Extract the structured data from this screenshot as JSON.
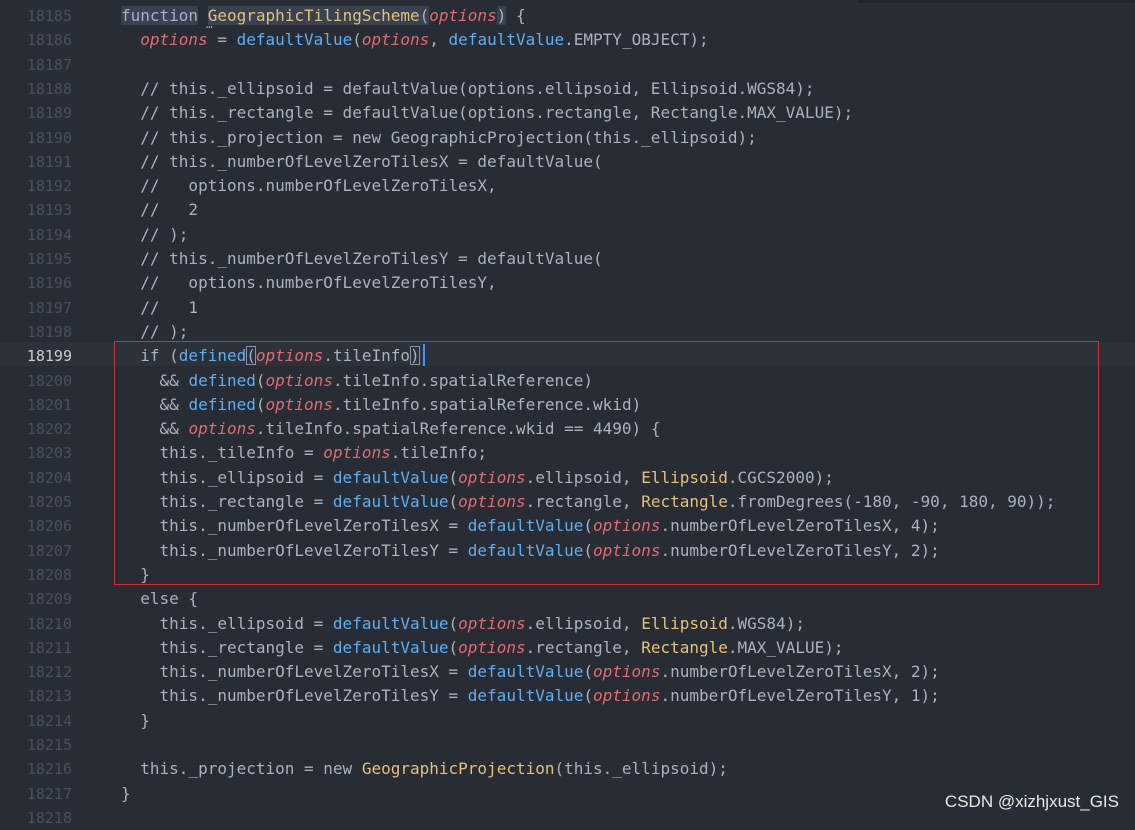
{
  "editor": {
    "current_line": "18199",
    "lines": [
      {
        "num": "18185",
        "tokens": [
          [
            "function",
            "kwsel"
          ],
          [
            " ",
            "plain"
          ],
          [
            "GeographicTilingScheme",
            "hlfn"
          ],
          [
            "(",
            "kwsel"
          ],
          [
            "options",
            "param"
          ],
          [
            ")",
            "kwsel"
          ],
          [
            " {",
            "plain"
          ]
        ]
      },
      {
        "num": "18186",
        "tokens": [
          [
            "  ",
            "plain"
          ],
          [
            "options",
            "param"
          ],
          [
            " = ",
            "plain"
          ],
          [
            "defaultValue",
            "fn"
          ],
          [
            "(",
            "plain"
          ],
          [
            "options",
            "param"
          ],
          [
            ", ",
            "plain"
          ],
          [
            "defaultValue",
            "fn"
          ],
          [
            ".EMPTY_OBJECT);",
            "plain"
          ]
        ]
      },
      {
        "num": "18187",
        "tokens": []
      },
      {
        "num": "18188",
        "tokens": [
          [
            "  // this._ellipsoid = defaultValue(options.ellipsoid, Ellipsoid.WGS84);",
            "comment"
          ]
        ]
      },
      {
        "num": "18189",
        "tokens": [
          [
            "  // this._rectangle = defaultValue(options.rectangle, Rectangle.MAX_VALUE);",
            "comment"
          ]
        ]
      },
      {
        "num": "18190",
        "tokens": [
          [
            "  // this._projection = new GeographicProjection(this._ellipsoid);",
            "comment"
          ]
        ]
      },
      {
        "num": "18191",
        "tokens": [
          [
            "  // this._numberOfLevelZeroTilesX = defaultValue(",
            "comment"
          ]
        ]
      },
      {
        "num": "18192",
        "tokens": [
          [
            "  //   options.numberOfLevelZeroTilesX,",
            "comment"
          ]
        ]
      },
      {
        "num": "18193",
        "tokens": [
          [
            "  //   2",
            "comment"
          ]
        ]
      },
      {
        "num": "18194",
        "tokens": [
          [
            "  // );",
            "comment"
          ]
        ]
      },
      {
        "num": "18195",
        "tokens": [
          [
            "  // this._numberOfLevelZeroTilesY = defaultValue(",
            "comment"
          ]
        ]
      },
      {
        "num": "18196",
        "tokens": [
          [
            "  //   options.numberOfLevelZeroTilesY,",
            "comment"
          ]
        ]
      },
      {
        "num": "18197",
        "tokens": [
          [
            "  //   1",
            "comment"
          ]
        ]
      },
      {
        "num": "18198",
        "tokens": [
          [
            "  // );",
            "comment"
          ]
        ]
      },
      {
        "num": "18199",
        "tokens": [
          [
            "  if (",
            "plain"
          ],
          [
            "defined",
            "fn"
          ],
          [
            "(",
            "bracket"
          ],
          [
            "options",
            "param"
          ],
          [
            ".tileInfo",
            "plain"
          ],
          [
            ")",
            "bracket"
          ]
        ]
      },
      {
        "num": "18200",
        "tokens": [
          [
            "    && ",
            "plain"
          ],
          [
            "defined",
            "fn"
          ],
          [
            "(",
            "plain"
          ],
          [
            "options",
            "param"
          ],
          [
            ".tileInfo.spatialReference)",
            "plain"
          ]
        ]
      },
      {
        "num": "18201",
        "tokens": [
          [
            "    && ",
            "plain"
          ],
          [
            "defined",
            "fn"
          ],
          [
            "(",
            "plain"
          ],
          [
            "options",
            "param"
          ],
          [
            ".tileInfo.spatialReference.wkid)",
            "plain"
          ]
        ]
      },
      {
        "num": "18202",
        "tokens": [
          [
            "    && ",
            "plain"
          ],
          [
            "options",
            "param"
          ],
          [
            ".tileInfo.spatialReference.wkid == 4490) {",
            "plain"
          ]
        ]
      },
      {
        "num": "18203",
        "tokens": [
          [
            "    this._tileInfo = ",
            "plain"
          ],
          [
            "options",
            "param"
          ],
          [
            ".tileInfo;",
            "plain"
          ]
        ]
      },
      {
        "num": "18204",
        "tokens": [
          [
            "    this._ellipsoid = ",
            "plain"
          ],
          [
            "defaultValue",
            "fn"
          ],
          [
            "(",
            "plain"
          ],
          [
            "options",
            "param"
          ],
          [
            ".ellipsoid, ",
            "plain"
          ],
          [
            "Ellipsoid",
            "class"
          ],
          [
            ".CGCS2000);",
            "plain"
          ]
        ]
      },
      {
        "num": "18205",
        "tokens": [
          [
            "    this._rectangle = ",
            "plain"
          ],
          [
            "defaultValue",
            "fn"
          ],
          [
            "(",
            "plain"
          ],
          [
            "options",
            "param"
          ],
          [
            ".rectangle, ",
            "plain"
          ],
          [
            "Rectangle",
            "class"
          ],
          [
            ".fromDegrees(-180, -90, 180, 90));",
            "plain"
          ]
        ]
      },
      {
        "num": "18206",
        "tokens": [
          [
            "    this._numberOfLevelZeroTilesX = ",
            "plain"
          ],
          [
            "defaultValue",
            "fn"
          ],
          [
            "(",
            "plain"
          ],
          [
            "options",
            "param"
          ],
          [
            ".numberOfLevelZeroTilesX, 4);",
            "plain"
          ]
        ]
      },
      {
        "num": "18207",
        "tokens": [
          [
            "    this._numberOfLevelZeroTilesY = ",
            "plain"
          ],
          [
            "defaultValue",
            "fn"
          ],
          [
            "(",
            "plain"
          ],
          [
            "options",
            "param"
          ],
          [
            ".numberOfLevelZeroTilesY, 2);",
            "plain"
          ]
        ]
      },
      {
        "num": "18208",
        "tokens": [
          [
            "  }",
            "plain"
          ]
        ]
      },
      {
        "num": "18209",
        "tokens": [
          [
            "  else {",
            "plain"
          ]
        ]
      },
      {
        "num": "18210",
        "tokens": [
          [
            "    this._ellipsoid = ",
            "plain"
          ],
          [
            "defaultValue",
            "fn"
          ],
          [
            "(",
            "plain"
          ],
          [
            "options",
            "param"
          ],
          [
            ".ellipsoid, ",
            "plain"
          ],
          [
            "Ellipsoid",
            "class"
          ],
          [
            ".WGS84);",
            "plain"
          ]
        ]
      },
      {
        "num": "18211",
        "tokens": [
          [
            "    this._rectangle = ",
            "plain"
          ],
          [
            "defaultValue",
            "fn"
          ],
          [
            "(",
            "plain"
          ],
          [
            "options",
            "param"
          ],
          [
            ".rectangle, ",
            "plain"
          ],
          [
            "Rectangle",
            "class"
          ],
          [
            ".MAX_VALUE);",
            "plain"
          ]
        ]
      },
      {
        "num": "18212",
        "tokens": [
          [
            "    this._numberOfLevelZeroTilesX = ",
            "plain"
          ],
          [
            "defaultValue",
            "fn"
          ],
          [
            "(",
            "plain"
          ],
          [
            "options",
            "param"
          ],
          [
            ".numberOfLevelZeroTilesX, 2);",
            "plain"
          ]
        ]
      },
      {
        "num": "18213",
        "tokens": [
          [
            "    this._numberOfLevelZeroTilesY = ",
            "plain"
          ],
          [
            "defaultValue",
            "fn"
          ],
          [
            "(",
            "plain"
          ],
          [
            "options",
            "param"
          ],
          [
            ".numberOfLevelZeroTilesY, 1);",
            "plain"
          ]
        ]
      },
      {
        "num": "18214",
        "tokens": [
          [
            "  }",
            "plain"
          ]
        ]
      },
      {
        "num": "18215",
        "tokens": []
      },
      {
        "num": "18216",
        "tokens": [
          [
            "  this._projection = new ",
            "plain"
          ],
          [
            "GeographicProjection",
            "class"
          ],
          [
            "(this._ellipsoid);",
            "plain"
          ]
        ]
      },
      {
        "num": "18217",
        "tokens": [
          [
            "}",
            "plain"
          ]
        ]
      },
      {
        "num": "18218",
        "tokens": []
      }
    ]
  },
  "watermark": "CSDN @xizhjxust_GIS",
  "colors": {
    "background": "#282c34",
    "function_name": "#61afef",
    "parameter": "#e06c75",
    "class_name": "#e5c07b",
    "highlight_box": "#c8353b"
  }
}
